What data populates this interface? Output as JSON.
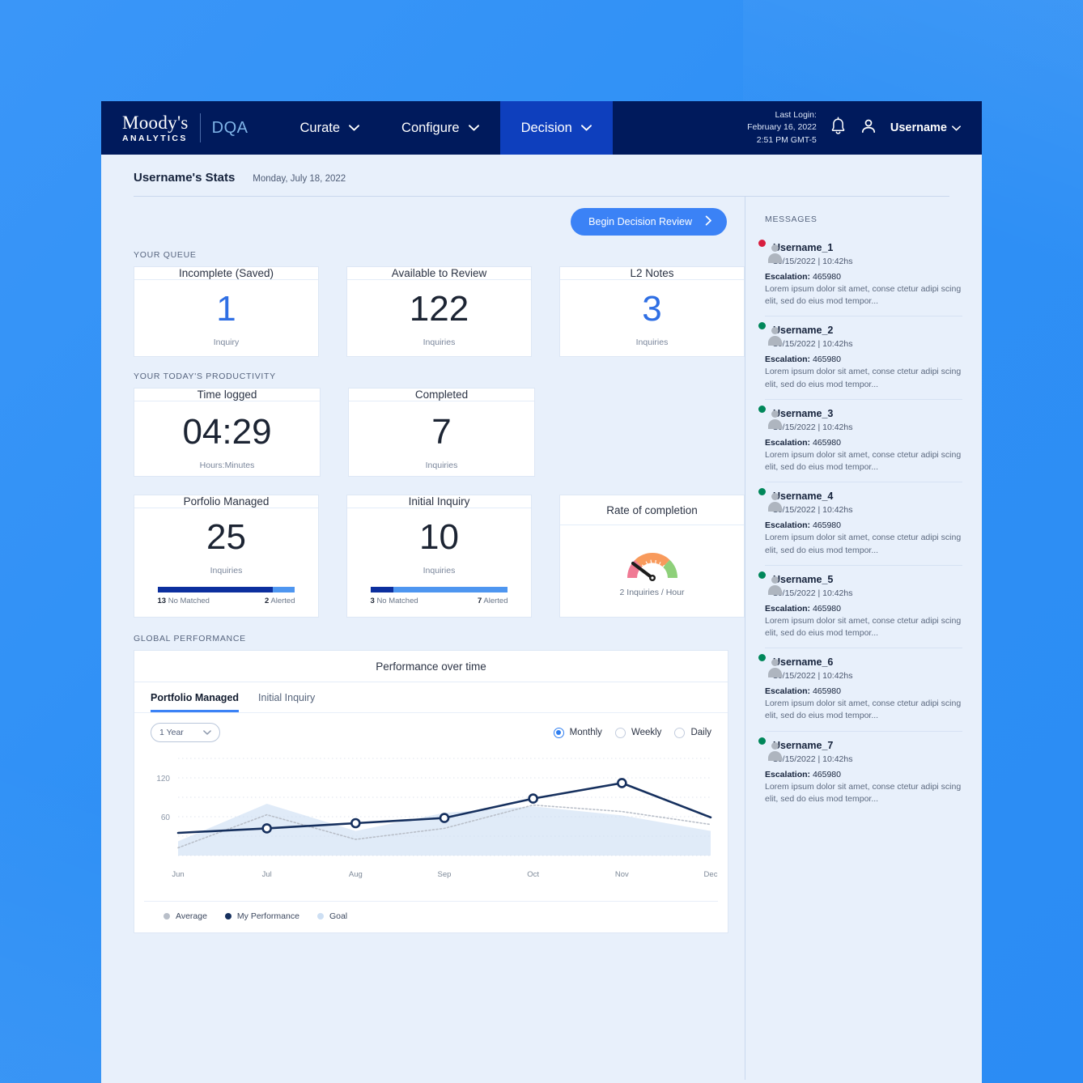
{
  "header": {
    "brand_primary": "Moody's",
    "brand_secondary": "ANALYTICS",
    "brand_product": "DQA",
    "nav": [
      {
        "label": "Curate",
        "active": false
      },
      {
        "label": "Configure",
        "active": false
      },
      {
        "label": "Decision",
        "active": true
      }
    ],
    "last_login_label": "Last Login:",
    "last_login_date": "February 16, 2022",
    "last_login_time": "2:51 PM GMT-5",
    "username": "Username"
  },
  "page": {
    "title": "Username's Stats",
    "date": "Monday, July 18, 2022",
    "review_button": "Begin Decision Review"
  },
  "queue": {
    "label": "YOUR QUEUE",
    "cards": [
      {
        "title": "Incomplete (Saved)",
        "value": "1",
        "unit": "Inquiry",
        "accent": "blue"
      },
      {
        "title": "Available to Review",
        "value": "122",
        "unit": "Inquiries",
        "accent": "dark"
      },
      {
        "title": "L2 Notes",
        "value": "3",
        "unit": "Inquiries",
        "accent": "blue"
      }
    ]
  },
  "productivity": {
    "label": "YOUR TODAY'S PRODUCTIVITY",
    "cards": [
      {
        "title": "Time logged",
        "value": "04:29",
        "unit": "Hours:Minutes"
      },
      {
        "title": "Completed",
        "value": "7",
        "unit": "Inquiries"
      }
    ],
    "metric_cards": [
      {
        "title": "Porfolio Managed",
        "value": "25",
        "unit": "Inquiries",
        "left_count": "13",
        "left_label": "No Matched",
        "right_count": "2",
        "right_label": "Alerted",
        "left_pct": 84,
        "right_pct": 16
      },
      {
        "title": "Initial Inquiry",
        "value": "10",
        "unit": "Inquiries",
        "left_count": "3",
        "left_label": "No Matched",
        "right_count": "7",
        "right_label": "Alerted",
        "left_pct": 17,
        "right_pct": 83
      }
    ],
    "gauge_card": {
      "title": "Rate of completion",
      "caption": "2 Inquiries / Hour",
      "needle_angle": -32
    }
  },
  "global_performance": {
    "label": "GLOBAL PERFORMANCE",
    "panel_title": "Performance over time",
    "tabs": [
      {
        "label": "Portfolio Managed",
        "active": true
      },
      {
        "label": "Initial Inquiry",
        "active": false
      }
    ],
    "range_select": "1 Year",
    "frequency": [
      {
        "label": "Monthly",
        "selected": true
      },
      {
        "label": "Weekly",
        "selected": false
      },
      {
        "label": "Daily",
        "selected": false
      }
    ]
  },
  "chart_data": {
    "type": "line",
    "title": "Performance over time",
    "xlabel": "",
    "ylabel": "",
    "x": [
      "Jun",
      "Jul",
      "Aug",
      "Sep",
      "Oct",
      "Nov",
      "Dec"
    ],
    "ylim": [
      0,
      150
    ],
    "yticks": [
      60,
      120
    ],
    "grid": true,
    "legend_position": "bottom-left",
    "series": [
      {
        "name": "My Performance",
        "color": "#16305e",
        "style": "solid-markers",
        "values": [
          35,
          42,
          50,
          58,
          88,
          112,
          59
        ]
      },
      {
        "name": "Average",
        "color": "#b9bfc9",
        "style": "dotted",
        "values": [
          12,
          63,
          25,
          42,
          78,
          68,
          48
        ]
      },
      {
        "name": "Goal",
        "color": "#cddff3",
        "style": "area",
        "values": [
          22,
          80,
          38,
          66,
          76,
          62,
          38
        ]
      }
    ]
  },
  "messages": {
    "label": "MESSAGES",
    "items": [
      {
        "name": "Username_1",
        "time": "10/15/2022 | 10:42hs",
        "escalation_label": "Escalation:",
        "escalation_id": "465980",
        "text": "Lorem ipsum dolor sit amet, conse ctetur adipi scing elit, sed do eius mod tempor...",
        "status_color": "#d81e3f"
      },
      {
        "name": "Username_2",
        "time": "10/15/2022 | 10:42hs",
        "escalation_label": "Escalation:",
        "escalation_id": "465980",
        "text": "Lorem ipsum dolor sit amet, conse ctetur adipi scing elit, sed do eius mod tempor...",
        "status_color": "#00875a"
      },
      {
        "name": "Username_3",
        "time": "10/15/2022 | 10:42hs",
        "escalation_label": "Escalation:",
        "escalation_id": "465980",
        "text": "Lorem ipsum dolor sit amet, conse ctetur adipi scing elit, sed do eius mod tempor...",
        "status_color": "#00875a"
      },
      {
        "name": "Username_4",
        "time": "10/15/2022 | 10:42hs",
        "escalation_label": "Escalation:",
        "escalation_id": "465980",
        "text": "Lorem ipsum dolor sit amet, conse ctetur adipi scing elit, sed do eius mod tempor...",
        "status_color": "#00875a"
      },
      {
        "name": "Username_5",
        "time": "10/15/2022 | 10:42hs",
        "escalation_label": "Escalation:",
        "escalation_id": "465980",
        "text": "Lorem ipsum dolor sit amet, conse ctetur adipi scing elit, sed do eius mod tempor...",
        "status_color": "#00875a"
      },
      {
        "name": "Username_6",
        "time": "10/15/2022 | 10:42hs",
        "escalation_label": "Escalation:",
        "escalation_id": "465980",
        "text": "Lorem ipsum dolor sit amet, conse ctetur adipi scing elit, sed do eius mod tempor...",
        "status_color": "#00875a"
      },
      {
        "name": "Username_7",
        "time": "10/15/2022 | 10:42hs",
        "escalation_label": "Escalation:",
        "escalation_id": "465980",
        "text": "Lorem ipsum dolor sit amet, conse ctetur adipi scing elit, sed do eius mod tempor...",
        "status_color": "#00875a"
      }
    ]
  },
  "colors": {
    "page_bg": "#2f90f5",
    "header_bg": "#001a5c",
    "nav_active": "#0e3fbd",
    "content_bg": "#e8f0fb",
    "accent_blue": "#3b82f6",
    "number_blue": "#2f6fe4",
    "bar_dark": "#0c2f9e",
    "bar_light": "#4e96f0"
  }
}
